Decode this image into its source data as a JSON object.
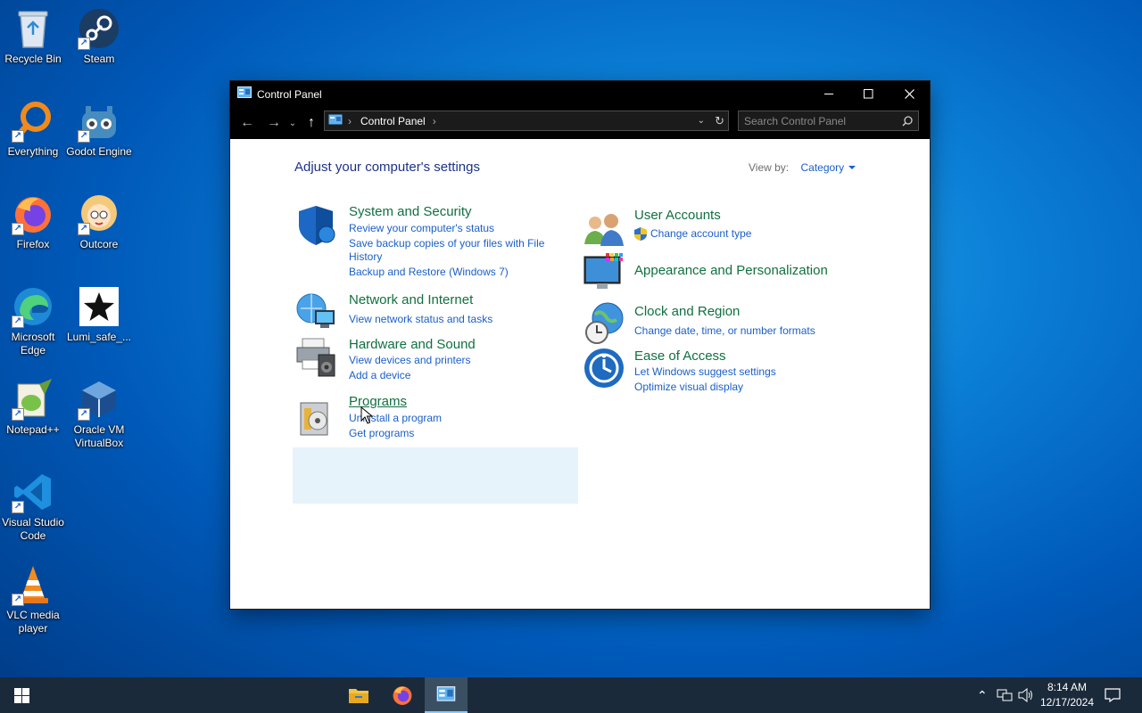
{
  "desktop": {
    "icons": [
      {
        "label": "Recycle Bin",
        "icon": "recycle-bin-icon"
      },
      {
        "label": "Steam",
        "icon": "steam-icon"
      },
      {
        "label": "Everything",
        "icon": "everything-search-icon"
      },
      {
        "label": "Godot Engine",
        "icon": "godot-icon"
      },
      {
        "label": "Firefox",
        "icon": "firefox-icon"
      },
      {
        "label": "Outcore",
        "icon": "outcore-icon"
      },
      {
        "label": "Microsoft Edge",
        "icon": "edge-icon"
      },
      {
        "label": "Lumi_safe_...",
        "icon": "star-icon"
      },
      {
        "label": "Notepad++",
        "icon": "notepad-plus-plus-icon"
      },
      {
        "label": "Oracle VM VirtualBox",
        "icon": "virtualbox-icon"
      },
      {
        "label": "Visual Studio Code",
        "icon": "vscode-icon"
      },
      {
        "label": "VLC media player",
        "icon": "vlc-icon"
      }
    ]
  },
  "window": {
    "title": "Control Panel",
    "address": {
      "crumb": "Control Panel"
    },
    "search": {
      "placeholder": "Search Control Panel"
    },
    "heading": "Adjust your computer's settings",
    "view_by": {
      "label": "View by:",
      "value": "Category"
    },
    "categories": [
      {
        "title": "System and Security",
        "icon": "shield-icon",
        "links": [
          "Review your computer's status",
          "Save backup copies of your files with File",
          "History",
          "Backup and Restore (Windows 7)"
        ]
      },
      {
        "title": "Network and Internet",
        "icon": "network-globe-icon",
        "links": [
          "View network status and tasks"
        ]
      },
      {
        "title": "Hardware and Sound",
        "icon": "printer-speaker-icon",
        "links": [
          "View devices and printers",
          "Add a device"
        ]
      },
      {
        "title": "Programs",
        "icon": "programs-disc-icon",
        "links": [
          "Uninstall a program",
          "Get programs"
        ]
      },
      {
        "title": "User Accounts",
        "icon": "users-icon",
        "links": [
          "Change account type"
        ]
      },
      {
        "title": "Appearance and Personalization",
        "icon": "monitor-palette-icon",
        "links": []
      },
      {
        "title": "Clock and Region",
        "icon": "clock-globe-icon",
        "links": [
          "Change date, time, or number formats"
        ]
      },
      {
        "title": "Ease of Access",
        "icon": "ease-of-access-icon",
        "links": [
          "Let Windows suggest settings",
          "Optimize visual display"
        ]
      }
    ]
  },
  "taskbar": {
    "apps": [
      "file-explorer-icon",
      "firefox-icon",
      "control-panel-icon"
    ],
    "clock": {
      "time": "8:14 AM",
      "date": "12/17/2024"
    }
  }
}
